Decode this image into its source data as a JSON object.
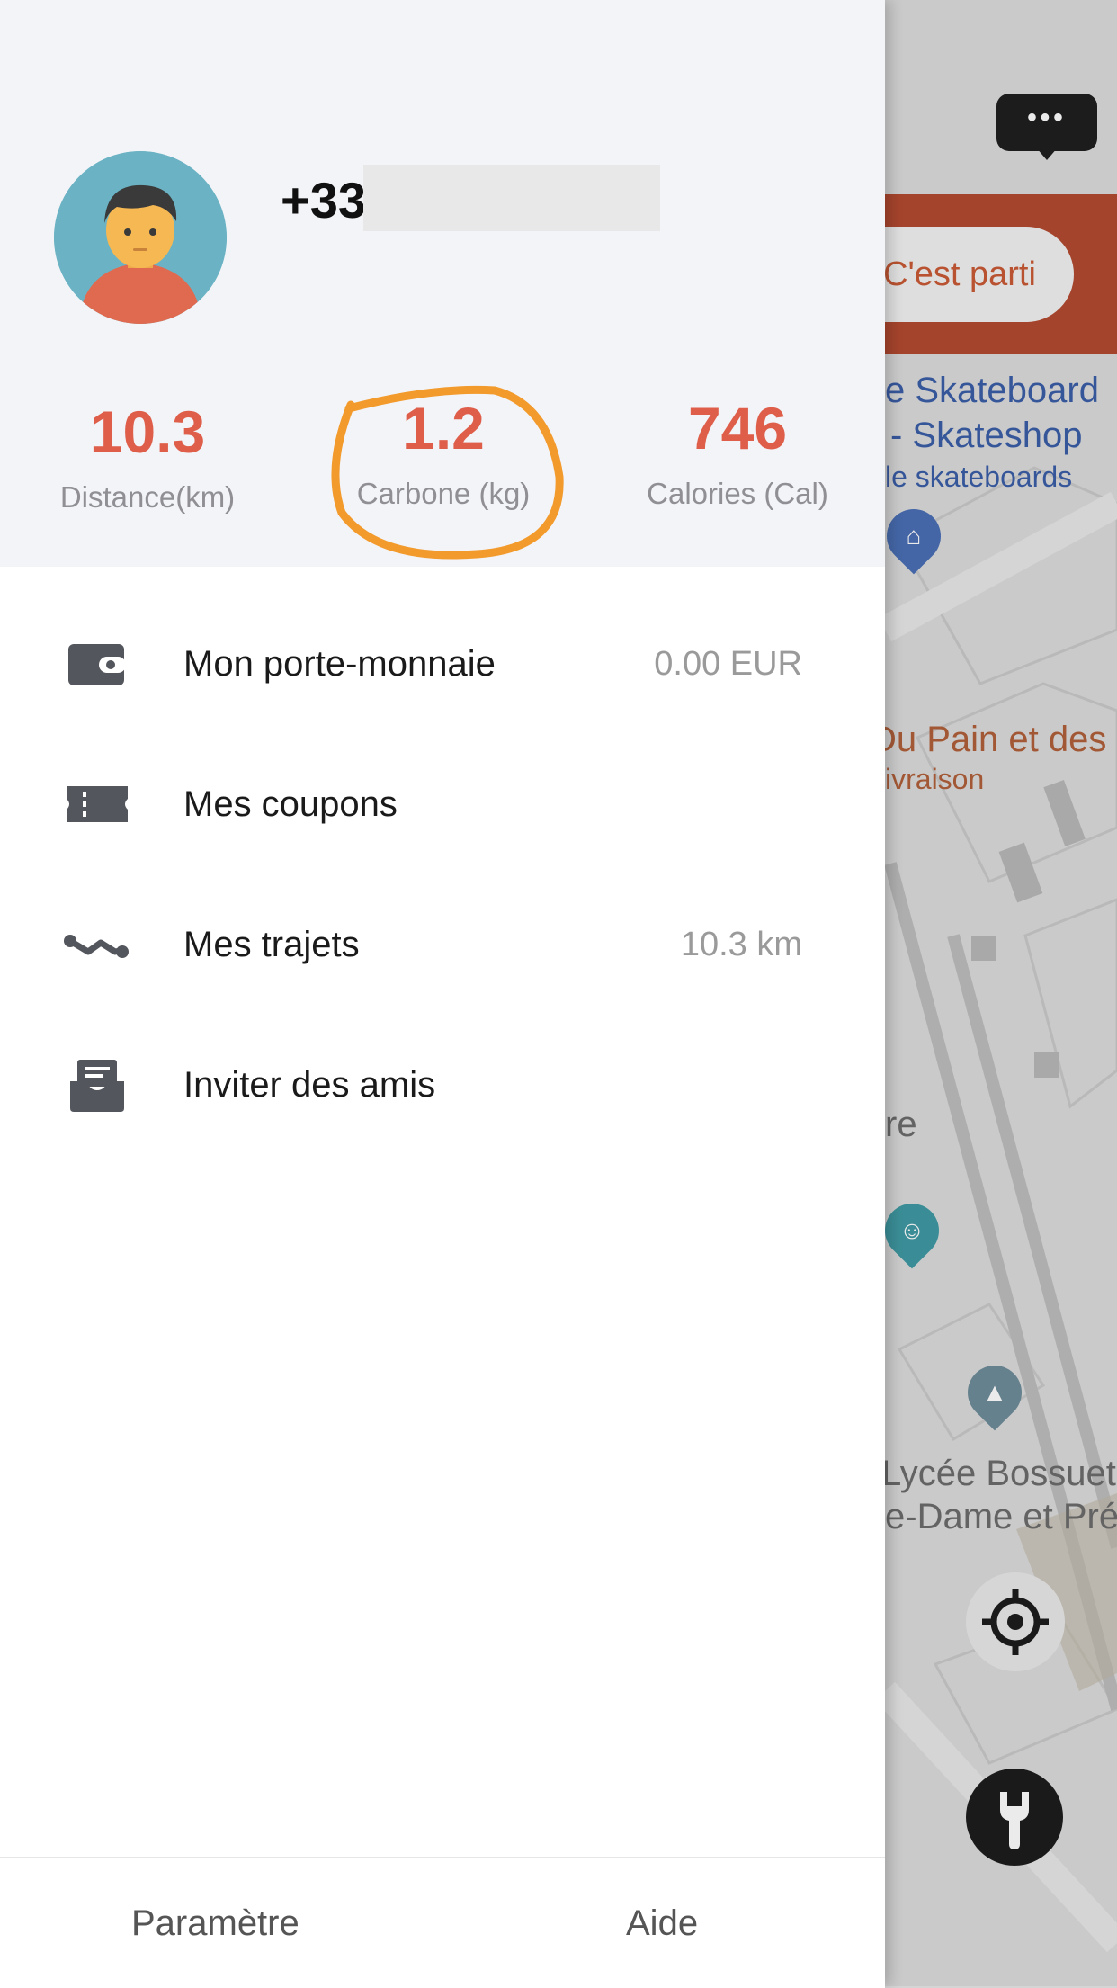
{
  "map": {
    "go_button": "C'est parti",
    "labels": {
      "skateboard_line1": "e Skateboard",
      "skateboard_line2": "- Skateshop",
      "skateboard_line3": "le skateboards",
      "bakery_line1": "Du Pain et des",
      "bakery_line2": "ivraison",
      "re": "re",
      "lycee_line1": "Lycée Bossuet",
      "lycee_line2": "e-Dame et Pré"
    },
    "chat_icon": "chat-bubble-icon",
    "locate_icon": "crosshair-icon",
    "tool_icon": "wrench-icon"
  },
  "profile": {
    "phone": "+33",
    "avatar_icon": "user-avatar-icon"
  },
  "stats": {
    "distance": {
      "value": "10.3",
      "label": "Distance(km)"
    },
    "carbon": {
      "value": "1.2",
      "label": "Carbone (kg)"
    },
    "calories": {
      "value": "746",
      "label": "Calories (Cal)"
    }
  },
  "menu": {
    "wallet": {
      "label": "Mon porte-monnaie",
      "value": "0.00 EUR",
      "icon": "wallet-icon"
    },
    "coupons": {
      "label": "Mes coupons",
      "icon": "ticket-icon"
    },
    "trips": {
      "label": "Mes trajets",
      "value": "10.3 km",
      "icon": "route-icon"
    },
    "invite": {
      "label": "Inviter des amis",
      "icon": "inbox-icon"
    }
  },
  "footer": {
    "settings": "Paramètre",
    "help": "Aide"
  },
  "colors": {
    "accent": "#de5e4a",
    "highlight_circle": "#f39a2c",
    "banner": "#b34a30"
  }
}
